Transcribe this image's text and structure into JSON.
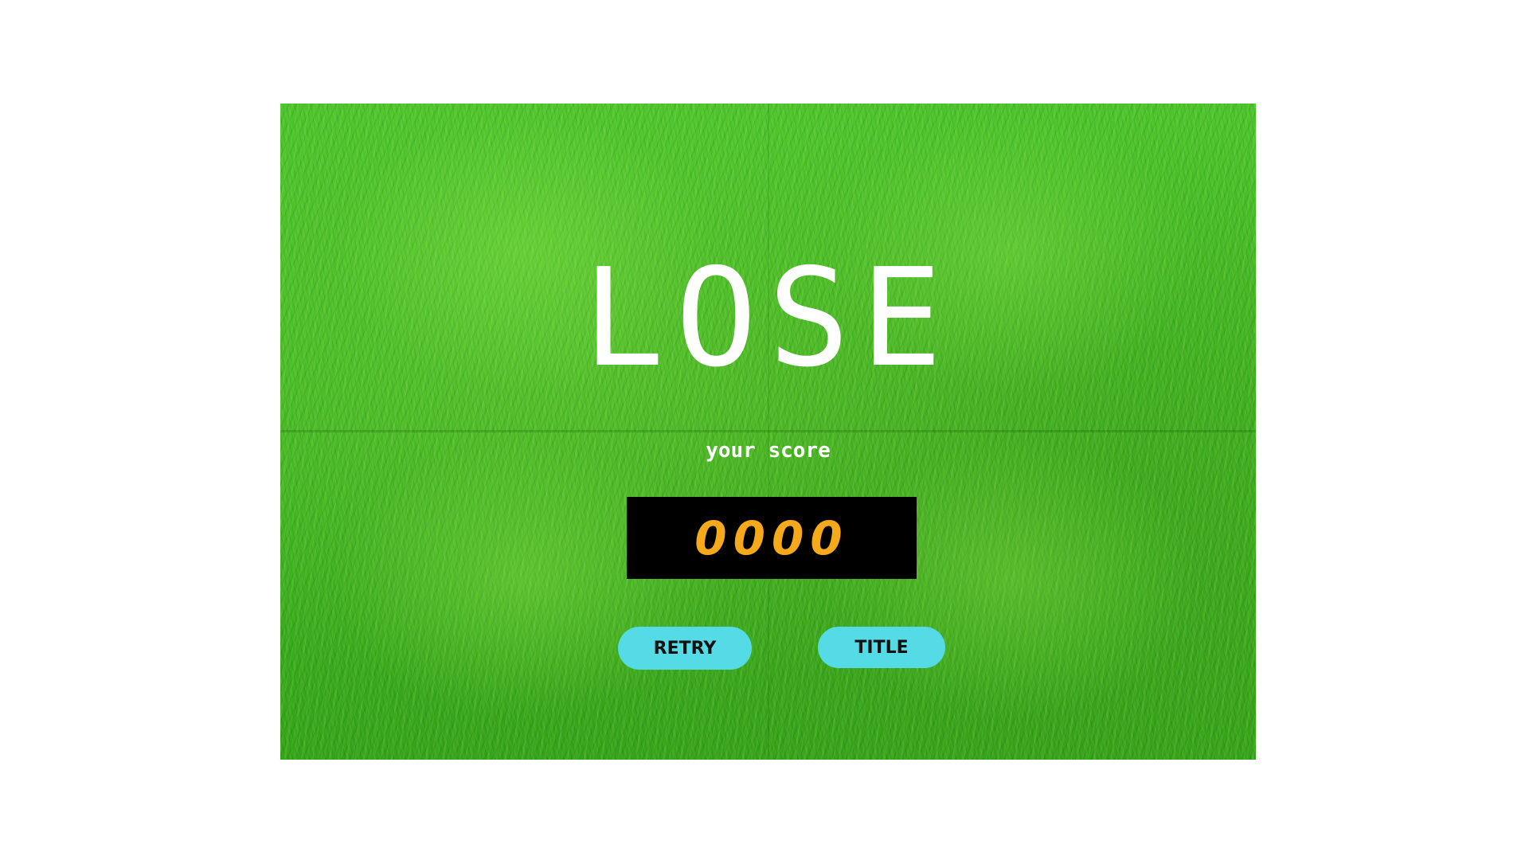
{
  "screen": {
    "result_title": "LOSE",
    "score_label": "your score",
    "score_value": "0000"
  },
  "buttons": {
    "retry_label": "RETRY",
    "title_label": "TITLE"
  },
  "colors": {
    "background_grass": "#3fb51f",
    "title_text": "#ffffff",
    "score_box": "#000000",
    "score_digits": "#f5a91b",
    "button_fill": "#54dbe5",
    "button_text": "#111111"
  }
}
